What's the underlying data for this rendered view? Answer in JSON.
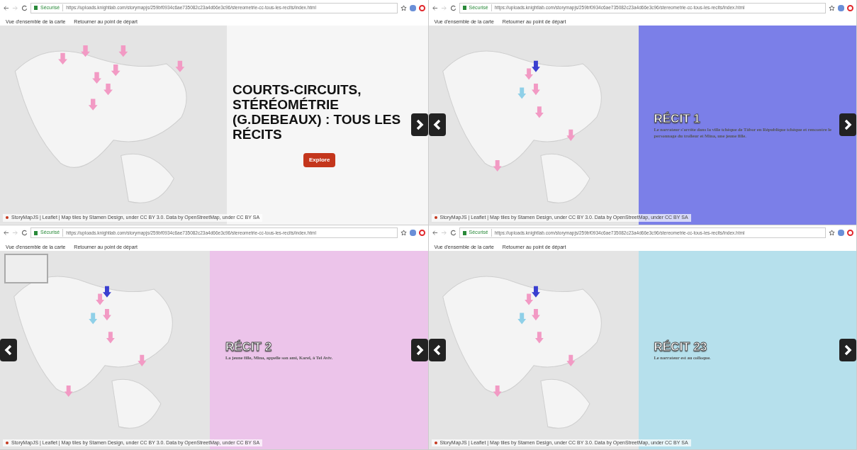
{
  "screens": [
    {
      "browser": {
        "secure_label": "Sécurisé",
        "url": "https://uploads.knightlab.com/storymapjs/259bf0934c6ae735082c23a4d66e3c96/stereometrie-cc-tous-les-recits/index.html"
      },
      "nav": [
        "Vue d'ensemble de la carte",
        "Retourner au point de départ"
      ],
      "slide": {
        "kind": "overview",
        "title": "COURTS-CIRCUITS, STÉRÉOMÉTRIE (G.DEBEAUX) : TOUS LES RÉCITS",
        "button": "Explore",
        "has_prev": false,
        "has_next": true
      },
      "attribution": "StoryMapJS | Leaflet | Map tiles by Stamen Design, under CC BY 3.0. Data by OpenStreetMap, under CC BY SA"
    },
    {
      "browser": {
        "secure_label": "Sécurisé",
        "url": "https://uploads.knightlab.com/storymapjs/259bf0934c6ae735082c23a4d66e3c96/stereometrie-cc-tous-les-recits/index.html"
      },
      "nav": [
        "Vue d'ensemble de la carte",
        "Retourner au point de départ"
      ],
      "slide": {
        "kind": "story",
        "title": "RÉCIT 1",
        "text": "Le narrateur s'arrête dans la ville tchèque de Tábor en République tchèque et rencontre le personnage du trolleur et Mina, une jeune fille.",
        "color": "#7b7fe8",
        "has_prev": true,
        "has_next": true
      },
      "attribution": "StoryMapJS | Leaflet | Map tiles by Stamen Design, under CC BY 3.0. Data by OpenStreetMap, under CC BY SA"
    },
    {
      "browser": {
        "secure_label": "Sécurisé",
        "url": "https://uploads.knightlab.com/storymapjs/259bf0934c6ae735082c23a4d66e3c96/stereometrie-cc-tous-les-recits/index.html"
      },
      "nav": [
        "Vue d'ensemble de la carte",
        "Retourner au point de départ"
      ],
      "slide": {
        "kind": "story",
        "title": "RÉCIT 2",
        "text": "La jeune fille, Mina, appelle son ami, Karel, à Tel Aviv.",
        "color": "#ecc4ea",
        "has_prev": true,
        "has_next": true,
        "minimap": true
      },
      "attribution": "StoryMapJS | Leaflet | Map tiles by Stamen Design, under CC BY 3.0. Data by OpenStreetMap, under CC BY SA"
    },
    {
      "browser": {
        "secure_label": "Sécurisé",
        "url": "https://uploads.knightlab.com/storymapjs/259bf0934c6ae735082c23a4d66e3c96/stereometrie-cc-tous-les-recits/index.html"
      },
      "nav": [
        "Vue d'ensemble de la carte",
        "Retourner au point de départ"
      ],
      "slide": {
        "kind": "story",
        "title": "RÉCIT 23",
        "text": "Le narrateur est au colloque.",
        "color": "#b6e0ec",
        "has_prev": true,
        "has_next": true
      },
      "attribution": "StoryMapJS | Leaflet | Map tiles by Stamen Design, under CC BY 3.0. Data by OpenStreetMap, under CC BY SA"
    }
  ]
}
